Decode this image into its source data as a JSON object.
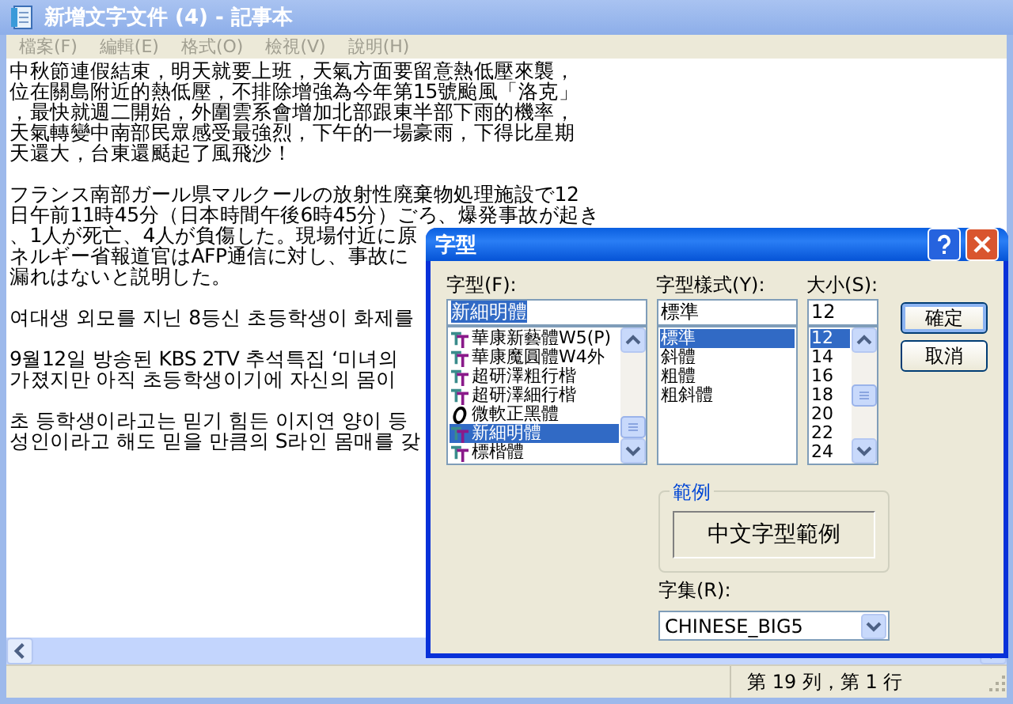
{
  "window": {
    "title": "新增文字文件 (4) - 記事本"
  },
  "menu": [
    "檔案(F)",
    "編輯(E)",
    "格式(O)",
    "檢視(V)",
    "說明(H)"
  ],
  "document": {
    "paragraphs": [
      {
        "lines": [
          "中秋節連假結束，明天就要上班，天氣方面要留意熱低壓來襲，",
          "位在關島附近的熱低壓，不排除增強為今年第15號颱風「洛克」",
          "，最快就週二開始，外圍雲系會增加北部跟東半部下雨的機率，",
          "天氣轉變中南部民眾感受最強烈，下午的一場豪雨，下得比星期",
          "天還大，台東還颳起了風飛沙！"
        ]
      },
      {
        "lines": [
          "フランス南部ガール県マルクールの放射性廃棄物処理施設で12",
          "日午前11時45分（日本時間午後6時45分）ごろ、爆発事故が起き",
          "、1人が死亡、4人が負傷した。現場付近に原",
          "ネルギー省報道官はAFP通信に対し、事故に",
          "漏れはないと説明した。"
        ]
      },
      {
        "lines": [
          "여대생 외모를 지닌 8등신 초등학생이 화제를"
        ]
      },
      {
        "lines": [
          "9월12일 방송된 KBS 2TV 추석특집 ‘미녀의",
          "가졌지만 아직 초등학생이기에 자신의 몸이"
        ]
      },
      {
        "lines": [
          "초 등학생이라고는 믿기 힘든 이지연 양이 등",
          "성인이라고 해도 믿을 만큼의 S라인 몸매를 갖"
        ]
      }
    ]
  },
  "status_bar": {
    "position": "第 19 列，第 1 行"
  },
  "font_dialog": {
    "title": "字型",
    "font": {
      "label": "字型(F):",
      "value": "新細明體",
      "items": [
        {
          "name": "華康新藝體W5(P)",
          "kind": "truetype",
          "selected": false
        },
        {
          "name": "華康魔圓體W4外",
          "kind": "truetype",
          "selected": false
        },
        {
          "name": "超研澤粗行楷",
          "kind": "truetype",
          "selected": false
        },
        {
          "name": "超研澤細行楷",
          "kind": "truetype",
          "selected": false
        },
        {
          "name": "微軟正黑體",
          "kind": "opentype",
          "selected": false
        },
        {
          "name": "新細明體",
          "kind": "truetype",
          "selected": true
        },
        {
          "name": "標楷體",
          "kind": "truetype",
          "selected": false
        }
      ]
    },
    "style": {
      "label": "字型樣式(Y):",
      "value": "標準",
      "items": [
        {
          "name": "標準",
          "selected": true
        },
        {
          "name": "斜體",
          "selected": false
        },
        {
          "name": "粗體",
          "selected": false
        },
        {
          "name": "粗斜體",
          "selected": false
        }
      ]
    },
    "size": {
      "label": "大小(S):",
      "value": "12",
      "items": [
        {
          "name": "12",
          "selected": true
        },
        {
          "name": "14",
          "selected": false
        },
        {
          "name": "16",
          "selected": false
        },
        {
          "name": "18",
          "selected": false
        },
        {
          "name": "20",
          "selected": false
        },
        {
          "name": "22",
          "selected": false
        },
        {
          "name": "24",
          "selected": false
        }
      ]
    },
    "buttons": [
      {
        "label": "確定",
        "default": true
      },
      {
        "label": "取消",
        "default": false
      }
    ],
    "sample": {
      "label": "範例",
      "text": "中文字型範例"
    },
    "charset": {
      "label": "字集(R):",
      "value": "CHINESE_BIG5"
    }
  }
}
